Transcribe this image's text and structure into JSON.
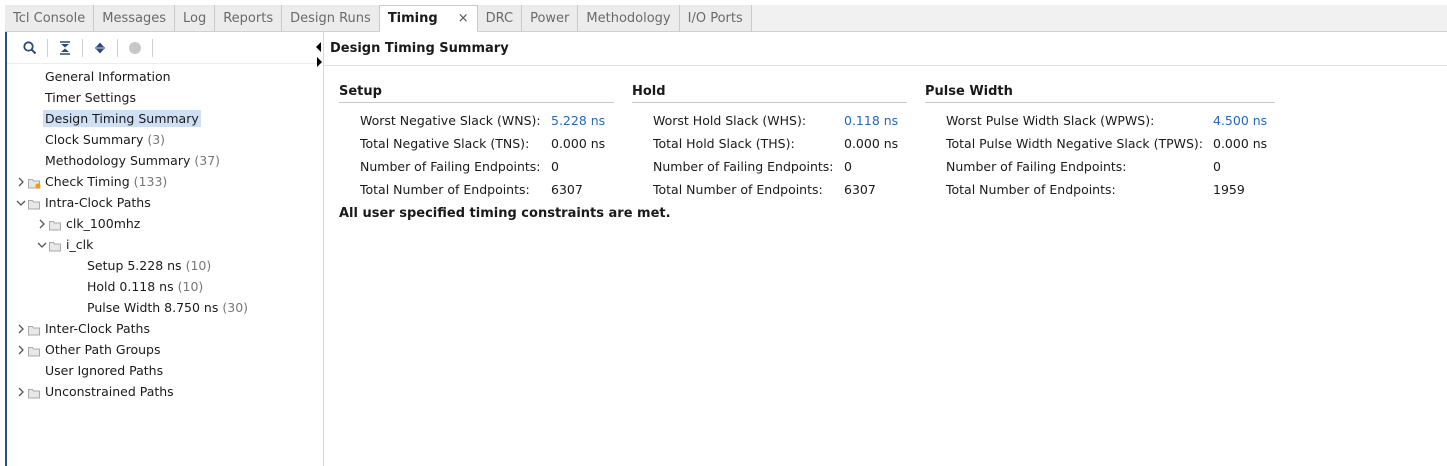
{
  "tabs": [
    {
      "label": "Tcl Console"
    },
    {
      "label": "Messages"
    },
    {
      "label": "Log"
    },
    {
      "label": "Reports"
    },
    {
      "label": "Design Runs"
    },
    {
      "label": "Timing",
      "active": true,
      "close": "×"
    },
    {
      "label": "DRC"
    },
    {
      "label": "Power"
    },
    {
      "label": "Methodology"
    },
    {
      "label": "I/O Ports"
    }
  ],
  "toolbar": {
    "icons": [
      "search-icon",
      "collapse-all-icon",
      "expand-all-icon",
      "stop-icon"
    ]
  },
  "tree": {
    "items": [
      {
        "label": "General Information",
        "count": ""
      },
      {
        "label": "Timer Settings",
        "count": ""
      },
      {
        "label": "Design Timing Summary",
        "count": "",
        "selected": true
      },
      {
        "label": "Clock Summary",
        "count": "(3)"
      },
      {
        "label": "Methodology Summary",
        "count": "(37)"
      },
      {
        "label": "Check Timing",
        "count": "(133)"
      },
      {
        "label": "Intra-Clock Paths",
        "count": ""
      },
      {
        "label": "clk_100mhz",
        "count": ""
      },
      {
        "label": "i_clk",
        "count": ""
      },
      {
        "label": "Setup 5.228 ns",
        "count": "(10)"
      },
      {
        "label": "Hold 0.118 ns",
        "count": "(10)"
      },
      {
        "label": "Pulse Width 8.750 ns",
        "count": "(30)"
      },
      {
        "label": "Inter-Clock Paths",
        "count": ""
      },
      {
        "label": "Other Path Groups",
        "count": ""
      },
      {
        "label": "User Ignored Paths",
        "count": ""
      },
      {
        "label": "Unconstrained Paths",
        "count": ""
      }
    ]
  },
  "summary": {
    "header": "Design Timing Summary",
    "setup": {
      "title": "Setup",
      "rows": [
        {
          "k": "Worst Negative Slack (WNS):",
          "v": "5.228 ns"
        },
        {
          "k": "Total Negative Slack (TNS):",
          "v": "0.000 ns"
        },
        {
          "k": "Number of Failing Endpoints:",
          "v": "0"
        },
        {
          "k": "Total Number of Endpoints:",
          "v": "6307"
        }
      ]
    },
    "hold": {
      "title": "Hold",
      "rows": [
        {
          "k": "Worst Hold Slack (WHS):",
          "v": "0.118 ns"
        },
        {
          "k": "Total Hold Slack (THS):",
          "v": "0.000 ns"
        },
        {
          "k": "Number of Failing Endpoints:",
          "v": "0"
        },
        {
          "k": "Total Number of Endpoints:",
          "v": "6307"
        }
      ]
    },
    "pulse": {
      "title": "Pulse Width",
      "rows": [
        {
          "k": "Worst Pulse Width Slack (WPWS):",
          "v": "4.500 ns"
        },
        {
          "k": "Total Pulse Width Negative Slack (TPWS):",
          "v": "0.000 ns"
        },
        {
          "k": "Number of Failing Endpoints:",
          "v": "0"
        },
        {
          "k": "Total Number of Endpoints:",
          "v": "1959"
        }
      ]
    },
    "footer": "All user specified timing constraints are met."
  },
  "colors": {
    "accent_link": "#2766c2",
    "selection": "#cfe0f5",
    "left_border": "#2d4f86"
  }
}
